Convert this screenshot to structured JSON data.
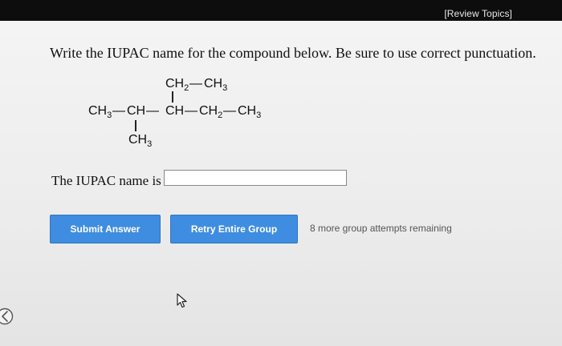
{
  "header": {
    "review_topics_label": "[Review Topics]"
  },
  "question": {
    "prompt": "Write the IUPAC name for the compound below. Be sure to use correct punctuation."
  },
  "structure": {
    "top_left": "CH",
    "top_left_sub": "2",
    "top_right": "CH",
    "top_right_sub": "3",
    "chain": [
      {
        "text": "CH",
        "sub": "3"
      },
      {
        "text": "CH",
        "sub": ""
      },
      {
        "text": "CH",
        "sub": ""
      },
      {
        "text": "CH",
        "sub": "2"
      },
      {
        "text": "CH",
        "sub": "3"
      }
    ],
    "bottom": "CH",
    "bottom_sub": "3"
  },
  "answer": {
    "label": "The IUPAC name is",
    "value": "",
    "placeholder": ""
  },
  "buttons": {
    "submit_label": "Submit Answer",
    "retry_label": "Retry Entire Group"
  },
  "attempts_text": "8 more group attempts remaining",
  "colors": {
    "button_blue": "#3f8de0",
    "topbar": "#0d0d0d"
  },
  "icons": {
    "cursor": "mouse-pointer-icon",
    "edge": "chevron-left-icon"
  }
}
